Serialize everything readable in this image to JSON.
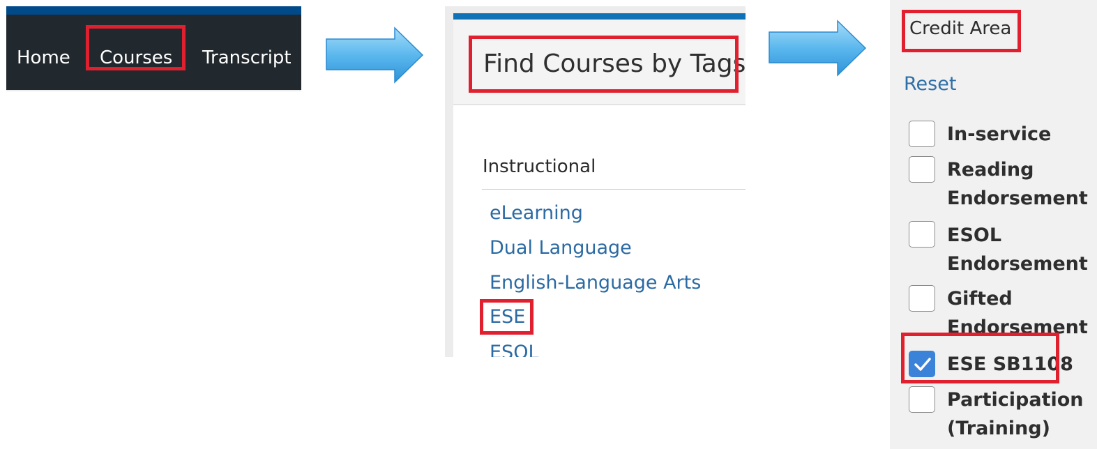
{
  "nav": {
    "items": [
      "Home",
      "Courses",
      "Transcript"
    ],
    "highlighted": "Courses"
  },
  "find_courses": {
    "title": "Find Courses by Tags",
    "section": "Instructional",
    "tags": [
      "eLearning",
      "Dual Language",
      "English-Language Arts",
      "ESE",
      "ESOL"
    ],
    "highlighted_tag": "ESE"
  },
  "credit_area": {
    "title": "Credit Area",
    "reset": "Reset",
    "options": [
      {
        "line1": "In-service",
        "line2": "",
        "checked": false
      },
      {
        "line1": "Reading",
        "line2": "Endorsement",
        "checked": false
      },
      {
        "line1": "ESOL",
        "line2": "Endorsement",
        "checked": false
      },
      {
        "line1": "Gifted",
        "line2": "Endorsement",
        "checked": false
      },
      {
        "line1": "ESE SB1108",
        "line2": "",
        "checked": true
      },
      {
        "line1": "Participation",
        "line2": "(Training)",
        "checked": false
      }
    ]
  },
  "colors": {
    "highlight": "#e0202e",
    "nav_bg": "#22292e",
    "link": "#2b6aa3",
    "checkbox_checked": "#3b83d9",
    "arrow": "#5bb8ee"
  },
  "icons": [
    "right-arrow-icon",
    "checkmark-icon"
  ]
}
